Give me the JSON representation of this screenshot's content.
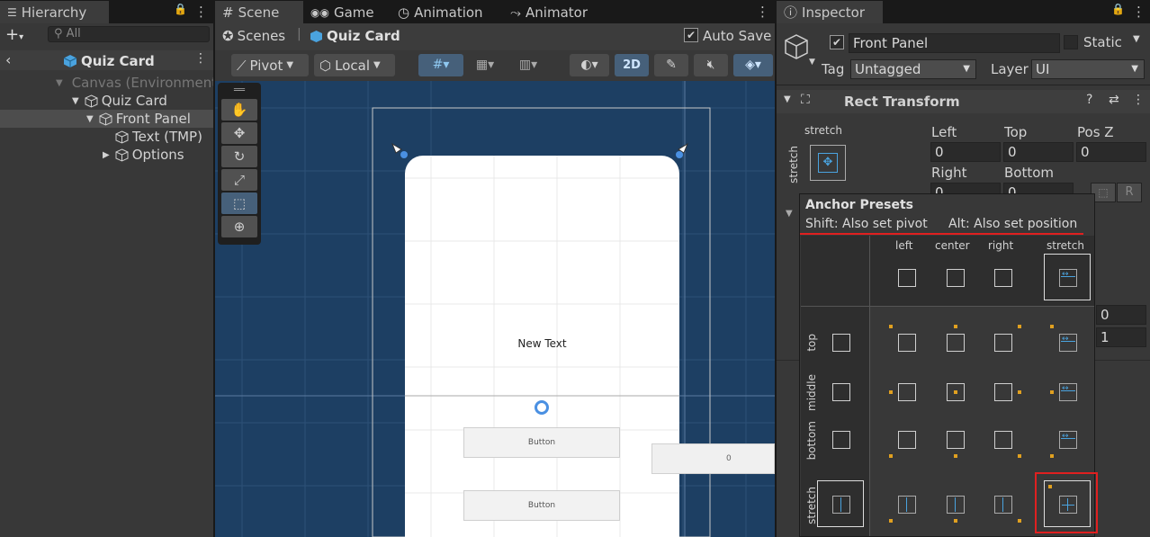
{
  "hierarchy": {
    "tab": "Hierarchy",
    "search_placeholder": "All",
    "breadcrumb": "Quiz Card",
    "items": [
      "Canvas (Environment)",
      "Quiz Card",
      "Front Panel",
      "Text (TMP)",
      "Options"
    ]
  },
  "scene_tabs": [
    "Scene",
    "Game",
    "Animation",
    "Animator"
  ],
  "scene_breadcrumb": {
    "root": "Scenes",
    "current": "Quiz Card"
  },
  "auto_save": "Auto Save",
  "toolbar": {
    "pivot": "Pivot",
    "local": "Local",
    "mode2d": "2D"
  },
  "canvas": {
    "new_text": "New Text",
    "button1": "Button",
    "button2": "Button",
    "side_value": "0"
  },
  "inspector": {
    "tab": "Inspector",
    "object_name": "Front Panel",
    "static_label": "Static",
    "tag_label": "Tag",
    "tag_value": "Untagged",
    "layer_label": "Layer",
    "layer_value": "UI",
    "component": "Rect Transform",
    "stretch_top": "stretch",
    "stretch_side": "stretch",
    "left_label": "Left",
    "top_label": "Top",
    "posz_label": "Pos Z",
    "left_value": "0",
    "top_value": "0",
    "posz_value": "0",
    "right_label": "Right",
    "bottom_label": "Bottom",
    "right_value": "0",
    "bottom_value": "0",
    "side_val1": "0",
    "side_val2": "1",
    "r_button": "R"
  },
  "anchor_presets": {
    "title": "Anchor Presets",
    "hint_shift": "Shift: Also set pivot",
    "hint_alt": "Alt: Also set position",
    "cols": [
      "left",
      "center",
      "right",
      "stretch"
    ],
    "rows": [
      "top",
      "middle",
      "bottom",
      "stretch"
    ]
  },
  "colors": {
    "highlight": "#e02020",
    "accent": "#4aa3df",
    "scene_bg": "#1d3f63"
  }
}
